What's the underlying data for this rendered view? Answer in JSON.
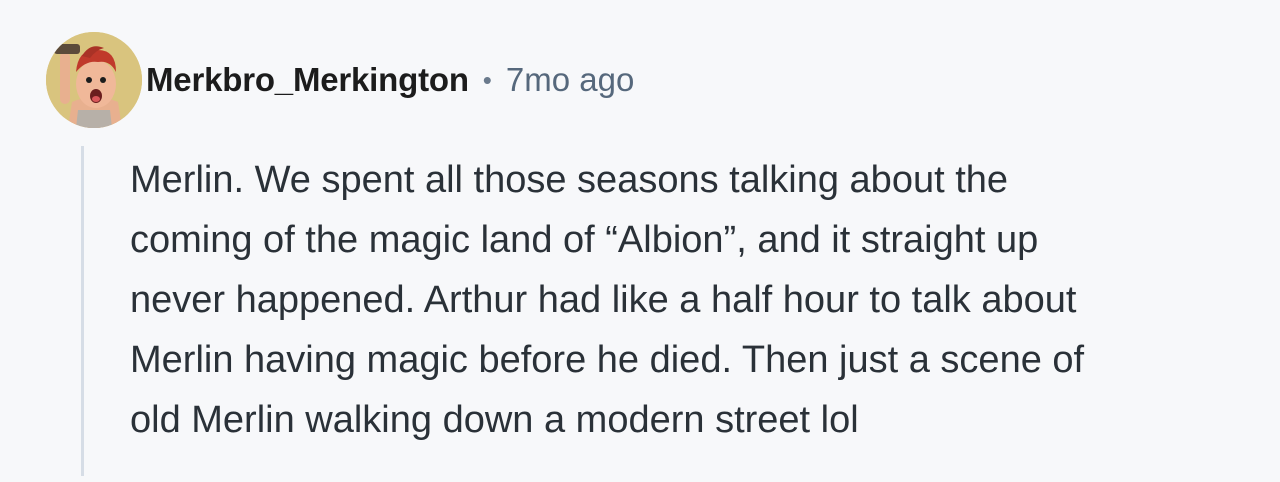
{
  "comment": {
    "username": "Merkbro_Merkington",
    "separator": "•",
    "timestamp": "7mo ago",
    "avatar_icon": "cartoon-user-avatar",
    "body_lines": [
      "Merlin. We spent all those seasons talking about the",
      "coming of the magic land of “Albion”, and it straight up",
      "never happened. Arthur had like a half hour to talk about",
      "Merlin having magic before he died. Then just a scene of",
      "old Merlin walking down a modern street lol"
    ]
  },
  "colors": {
    "background": "#f7f8fa",
    "username": "#1c1c1c",
    "timestamp": "#56687c",
    "body": "#2a3138",
    "thread_line": "#d6dde6"
  }
}
